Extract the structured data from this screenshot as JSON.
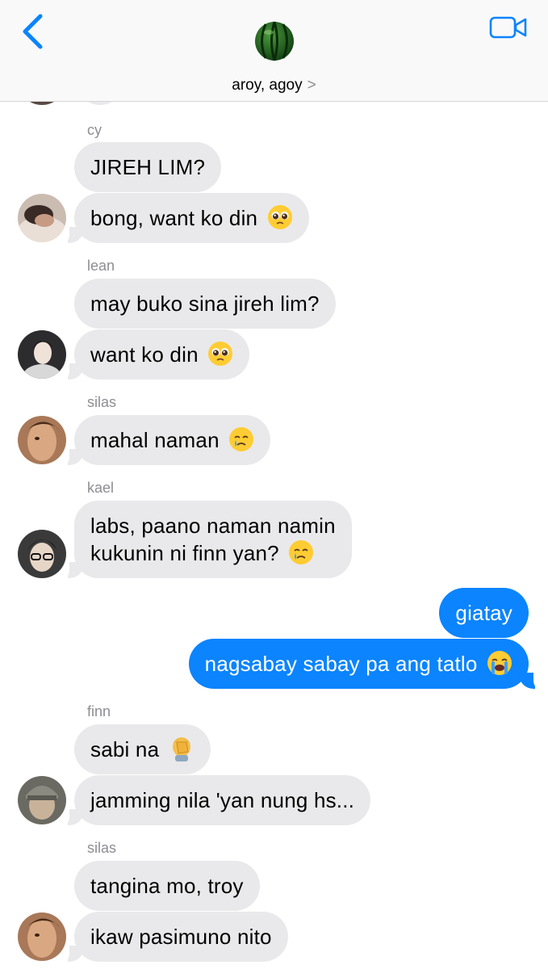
{
  "header": {
    "group_name": "aroy, agoy",
    "chevron": ">",
    "back_icon": "chevron-left-icon",
    "video_icon": "video-camera-icon",
    "group_avatar": "watermelon-icon",
    "accent": "#0b84fe"
  },
  "messages": [
    {
      "sender": "cy",
      "text": "JIREH LIM?"
    },
    {
      "text": "bong, want ko din",
      "emoji": "pleading-face-icon"
    },
    {
      "sender": "lean",
      "text": "may buko sina jireh lim?"
    },
    {
      "text": "want ko din",
      "emoji": "pleading-face-icon"
    },
    {
      "sender": "silas",
      "text": "mahal naman",
      "emoji": "crying-face-icon"
    },
    {
      "sender": "kael",
      "line1": "labs, paano naman namin",
      "line2": "kukunin ni finn yan?",
      "emoji": "crying-face-icon"
    },
    {
      "text": "giatay",
      "outgoing": true
    },
    {
      "text": "nagsabay sabay pa ang tatlo",
      "emoji": "loudly-crying-face-icon",
      "outgoing": true
    },
    {
      "sender": "finn",
      "text": "sabi na",
      "emoji": "face-palm-icon"
    },
    {
      "text": "jamming nila 'yan nung hs..."
    },
    {
      "sender": "silas",
      "text": "tangina mo, troy"
    },
    {
      "text": "ikaw pasimuno nito"
    }
  ],
  "colors": {
    "incoming_bubble": "#e9e9eb",
    "outgoing_bubble": "#0b84fe",
    "sender_label": "#8e8e93"
  }
}
